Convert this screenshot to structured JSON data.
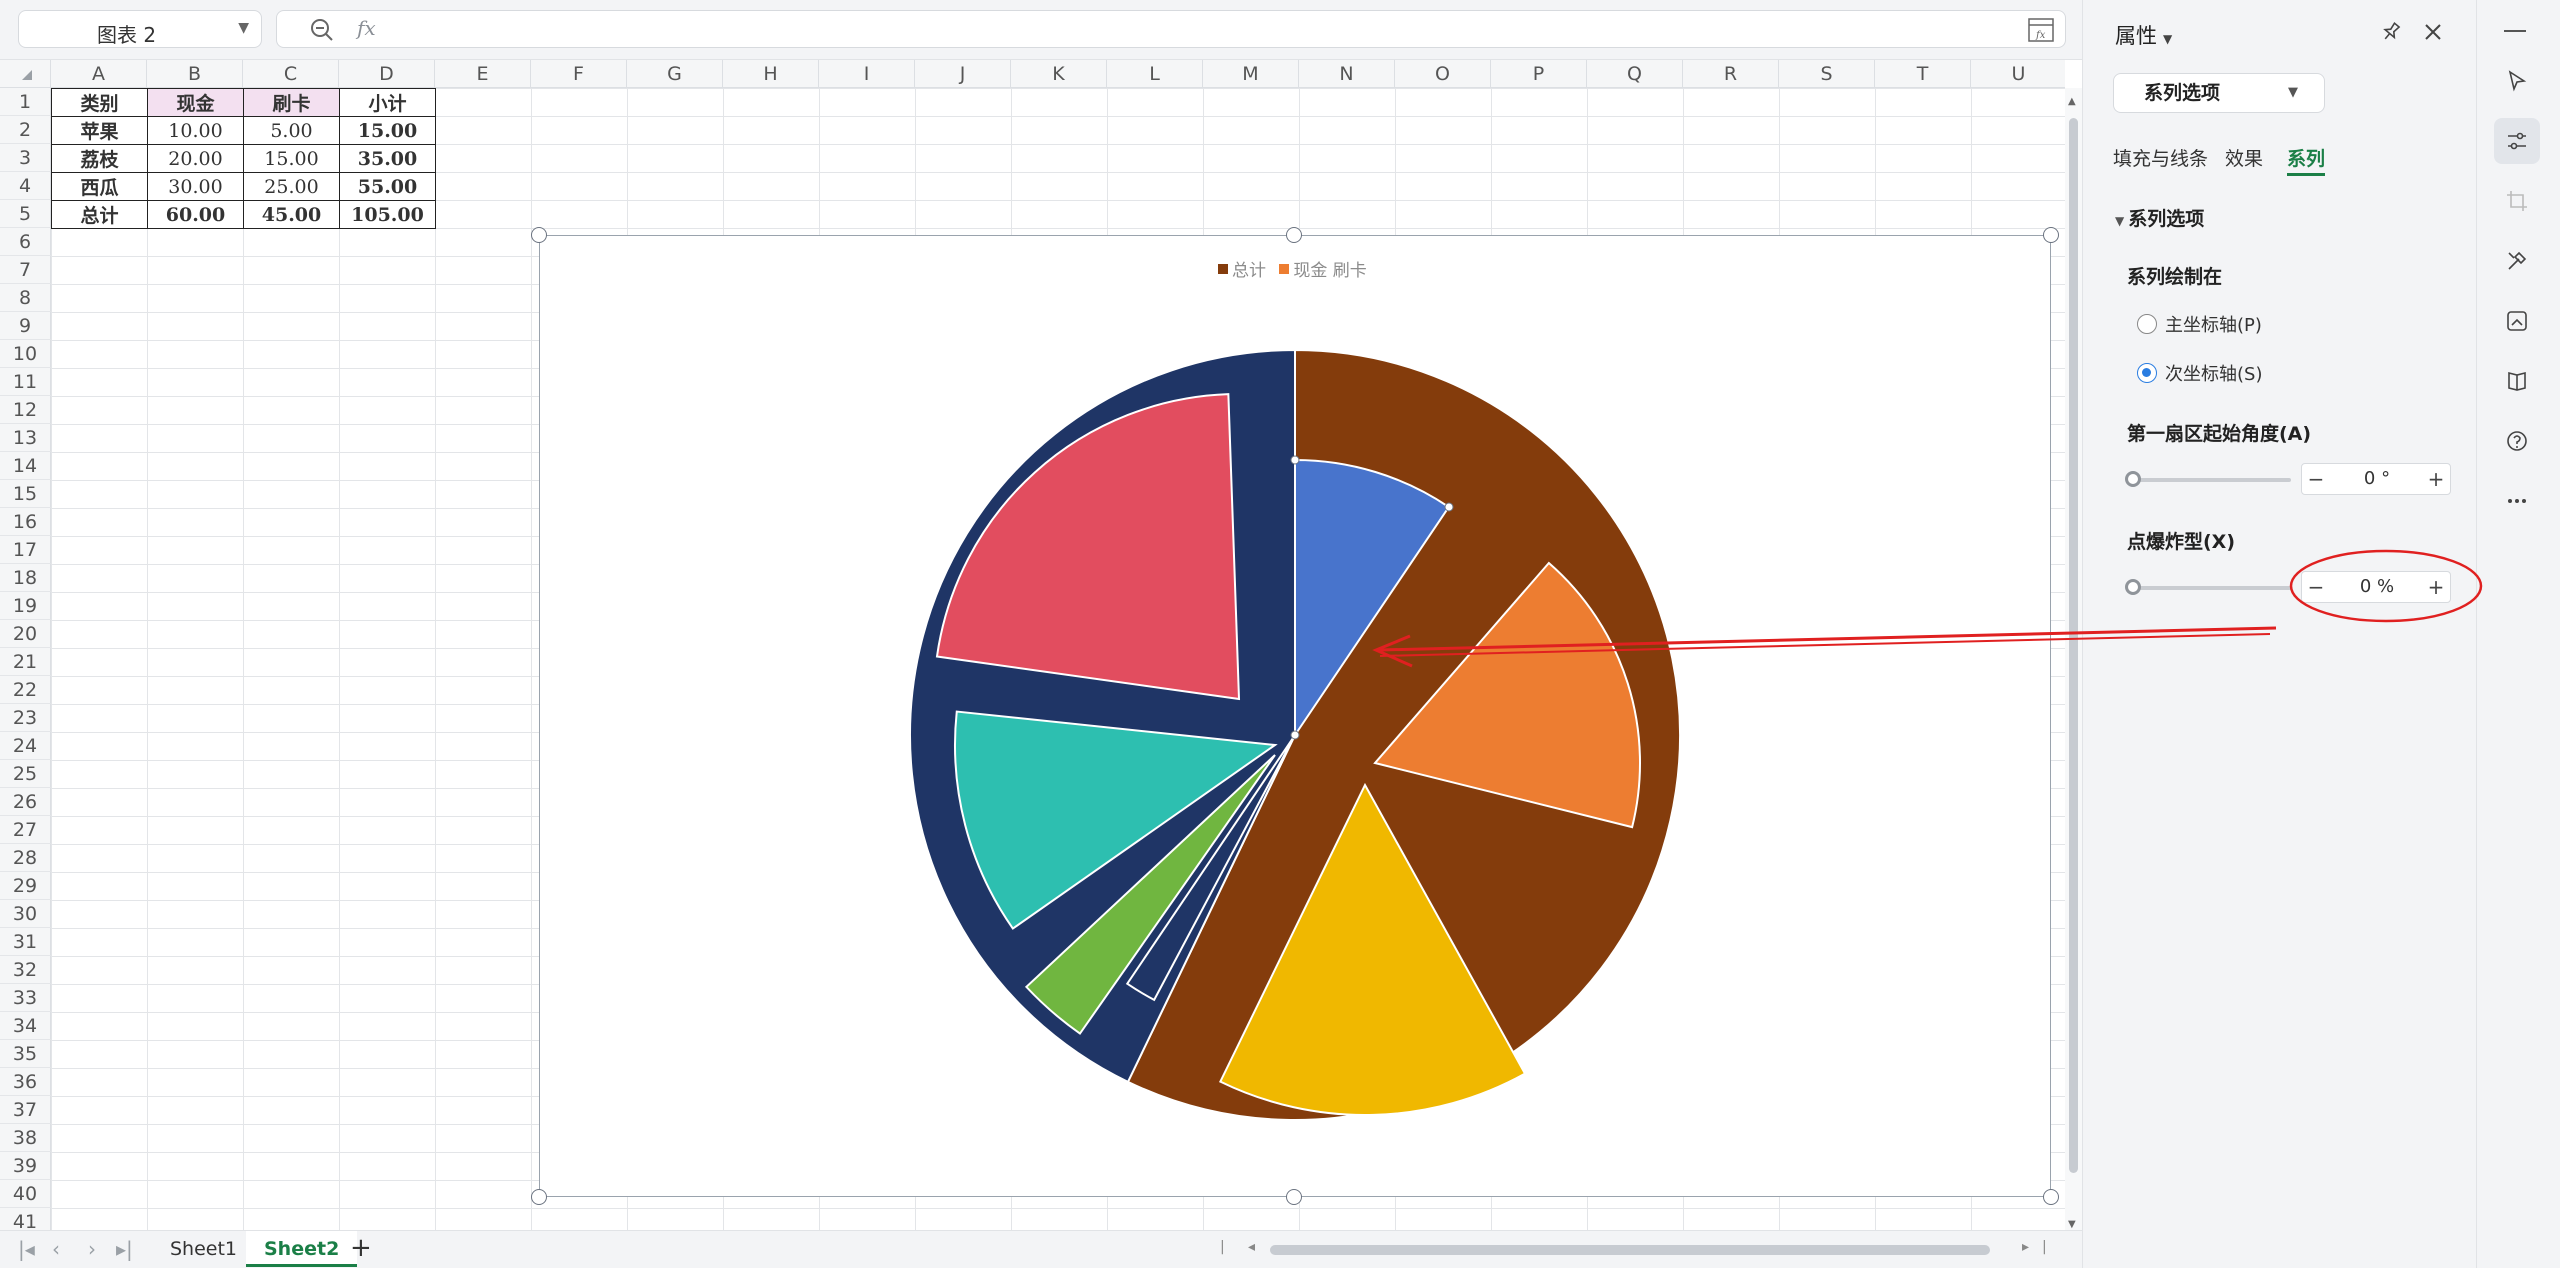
{
  "formula_bar": {
    "name_box": "图表 2",
    "fx_label": "fx",
    "formula": ""
  },
  "grid": {
    "columns": [
      "A",
      "B",
      "C",
      "D",
      "E",
      "F",
      "G",
      "H",
      "I",
      "J",
      "K",
      "L",
      "M",
      "N",
      "O",
      "P",
      "Q",
      "R",
      "S",
      "T",
      "U"
    ],
    "rows": [
      "1",
      "2",
      "3",
      "4",
      "5",
      "6",
      "7",
      "8",
      "9",
      "10",
      "11",
      "12",
      "13",
      "14",
      "15",
      "16",
      "17",
      "18",
      "19",
      "20",
      "21",
      "22",
      "23",
      "24",
      "25",
      "26",
      "27",
      "28",
      "29",
      "30",
      "31",
      "32",
      "33",
      "34",
      "35",
      "36",
      "37",
      "38",
      "39",
      "40",
      "41"
    ]
  },
  "table": {
    "header": [
      "类别",
      "现金",
      "刷卡",
      "小计"
    ],
    "rows": [
      [
        "苹果",
        "10.00",
        "5.00",
        "15.00"
      ],
      [
        "荔枝",
        "20.00",
        "15.00",
        "35.00"
      ],
      [
        "西瓜",
        "30.00",
        "25.00",
        "55.00"
      ],
      [
        "总计",
        "60.00",
        "45.00",
        "105.00"
      ]
    ]
  },
  "chart_data": {
    "type": "pie",
    "title": "",
    "legend": [
      "总计",
      "现金 刷卡"
    ],
    "legend_colors": [
      "#843c0c",
      "#ed7d31"
    ],
    "outer_series": {
      "name": "总计",
      "values": [
        60,
        45
      ],
      "colors": [
        "#843c0c",
        "#1f3566"
      ]
    },
    "inner_series": {
      "name": "现金 刷卡",
      "values": [
        10,
        20,
        30,
        5,
        15,
        25,
        0
      ],
      "colors": [
        "#4874cc",
        "#ed7d31",
        "#f0b800",
        "#1f3566",
        "#70b640",
        "#2dbfb0",
        "#e24d5f"
      ]
    },
    "note_visible_slices": "outer pie with exploded inner slices"
  },
  "sheets": {
    "tabs": [
      "Sheet1",
      "Sheet2"
    ],
    "active": "Sheet2",
    "add": "+"
  },
  "panel": {
    "title": "属性",
    "dropdown": "系列选项",
    "tabs": [
      "填充与线条",
      "效果",
      "系列"
    ],
    "active_tab": "系列",
    "section": "系列选项",
    "plot_on_label": "系列绘制在",
    "primary_axis": "主坐标轴(P)",
    "secondary_axis": "次坐标轴(S)",
    "selected_axis": "secondary",
    "first_angle_label": "第一扇区起始角度(A)",
    "first_angle_value": "0 °",
    "explode_label": "点爆炸型(X)",
    "explode_value": "0 %"
  },
  "colors": {
    "accent": "#1b7f47",
    "annotation": "#e02020"
  }
}
